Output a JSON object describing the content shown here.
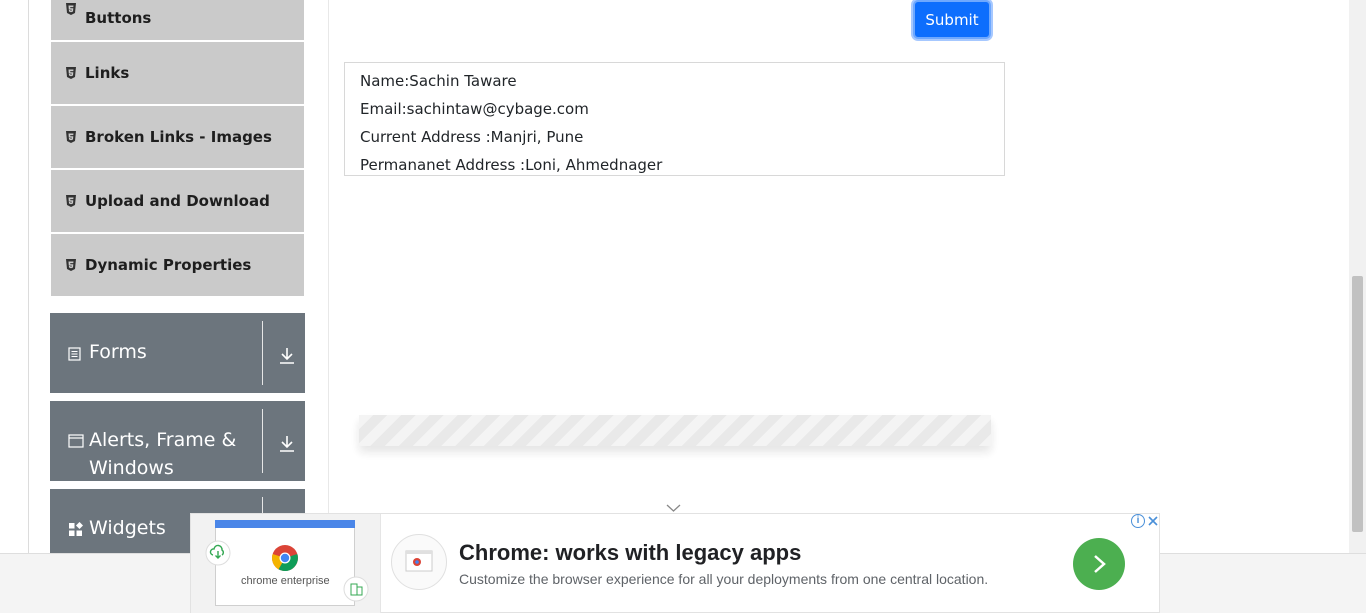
{
  "sidebar": {
    "items": [
      {
        "label": "Buttons"
      },
      {
        "label": "Links"
      },
      {
        "label": "Broken Links - Images"
      },
      {
        "label": "Upload and Download"
      },
      {
        "label": "Dynamic Properties"
      }
    ],
    "groups": [
      {
        "label": "Forms",
        "icon": "document-icon"
      },
      {
        "label_line1": "Alerts, Frame &",
        "label_line2": "Windows",
        "icon": "window-icon"
      },
      {
        "label": "Widgets",
        "icon": "widgets-icon"
      }
    ]
  },
  "form": {
    "submit_label": "Submit"
  },
  "output": {
    "name": "Name:Sachin Taware",
    "email": "Email:sachintaw@cybage.com",
    "current_address": "Current Address :Manjri, Pune",
    "permanent_address": "Permananet Address :Loni, Ahmednager"
  },
  "ad": {
    "title": "Chrome: works with legacy apps",
    "description": "Customize the browser experience for all your deployments from one central location.",
    "brand_caption": "chrome enterprise"
  },
  "colors": {
    "accent": "#0d6efd",
    "sidebar_group": "#6c757d",
    "sidebar_item": "#cacaca",
    "ad_cta": "#4caf50"
  }
}
